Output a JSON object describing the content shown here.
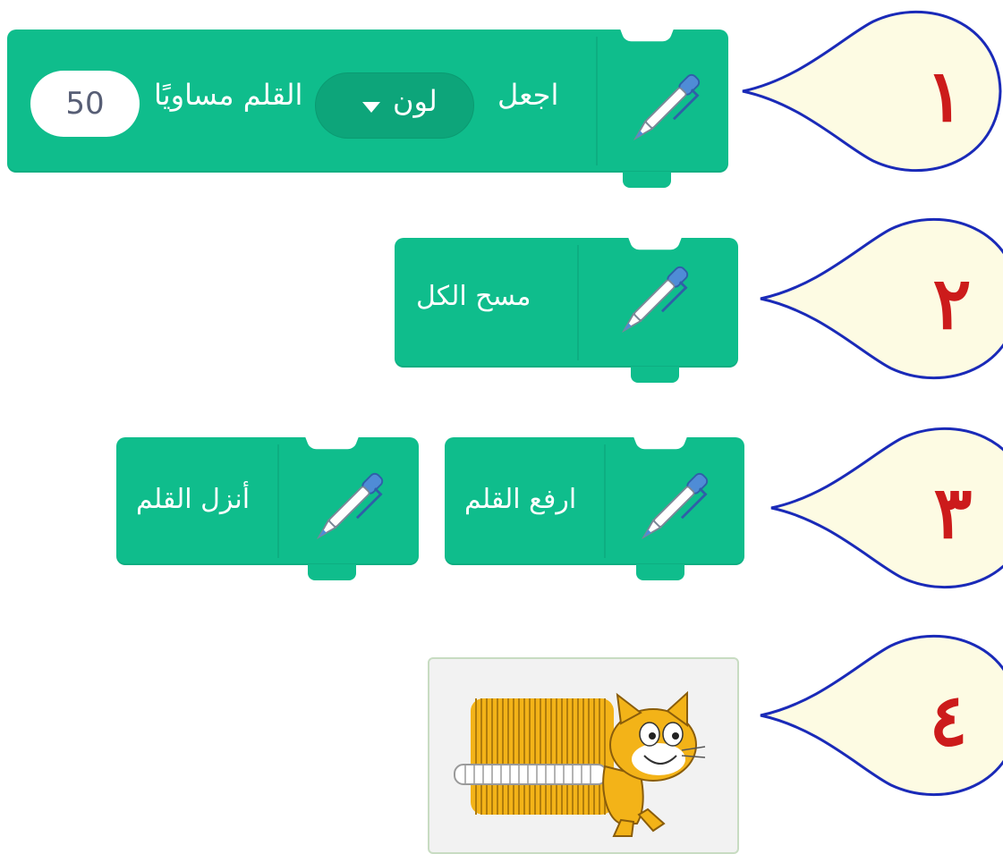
{
  "blocks": {
    "set_pen": {
      "verb": "اجعل",
      "dropdown_value": "لون",
      "suffix": "القلم مساويًا",
      "number": "50"
    },
    "clear": {
      "label": "مسح الكل"
    },
    "pen_up": {
      "label": "ارفع القلم"
    },
    "pen_down": {
      "label": "أنزل القلم"
    }
  },
  "callouts": [
    "١",
    "٢",
    "٣",
    "٤"
  ],
  "colors": {
    "block": "#0fbd8c",
    "callout_border": "#1a2ab8",
    "callout_fill": "#fdfbe3",
    "callout_number": "#cc1b1b"
  },
  "icons": [
    "pen-icon",
    "dropdown-arrow-icon",
    "scratch-cat-sprite"
  ]
}
